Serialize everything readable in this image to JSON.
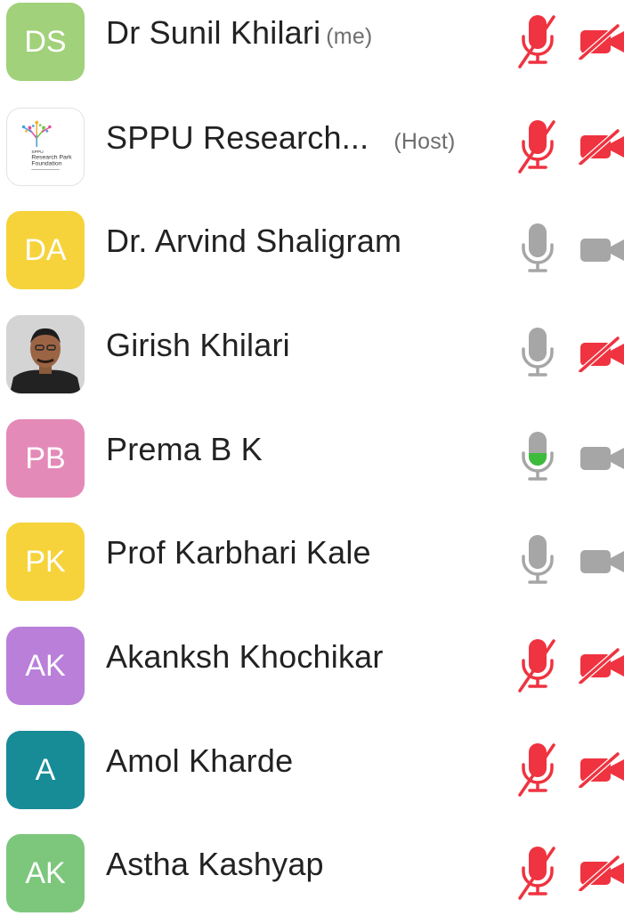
{
  "participants": [
    {
      "initials": "DS",
      "name": "Dr Sunil Khilari",
      "tag": "(me)",
      "avatar_type": "initials",
      "avatar_color": "#a1d17a",
      "mic": "muted",
      "video": "off"
    },
    {
      "initials": "",
      "name": "SPPU Research...",
      "tag": "(Host)",
      "avatar_type": "logo",
      "avatar_color": "#ffffff",
      "mic": "muted",
      "video": "off",
      "logo_text": {
        "line1": "SPPU",
        "line2": "Research Park",
        "line3": "Foundation"
      }
    },
    {
      "initials": "DA",
      "name": "Dr. Arvind Shaligram",
      "tag": "",
      "avatar_type": "initials",
      "avatar_color": "#f6d33b",
      "mic": "on",
      "video": "on"
    },
    {
      "initials": "",
      "name": "Girish Khilari",
      "tag": "",
      "avatar_type": "photo",
      "avatar_color": "#cfcfcf",
      "mic": "on",
      "video": "off"
    },
    {
      "initials": "PB",
      "name": "Prema B K",
      "tag": "",
      "avatar_type": "initials",
      "avatar_color": "#e48ab8",
      "mic": "speaking",
      "video": "on"
    },
    {
      "initials": "PK",
      "name": "Prof Karbhari Kale",
      "tag": "",
      "avatar_type": "initials",
      "avatar_color": "#f6d33b",
      "mic": "on",
      "video": "on"
    },
    {
      "initials": "AK",
      "name": "Akanksh Khochikar",
      "tag": "",
      "avatar_type": "initials",
      "avatar_color": "#b97fd9",
      "mic": "muted",
      "video": "off"
    },
    {
      "initials": "A",
      "name": "Amol Kharde",
      "tag": "",
      "avatar_type": "initials",
      "avatar_color": "#178c97",
      "mic": "muted",
      "video": "off"
    },
    {
      "initials": "AK",
      "name": "Astha Kashyap",
      "tag": "",
      "avatar_type": "initials",
      "avatar_color": "#7dc77c",
      "mic": "muted",
      "video": "off"
    }
  ],
  "icons": {
    "mic_muted": "mic-muted-icon",
    "mic_on": "mic-icon",
    "mic_speaking": "mic-speaking-icon",
    "video_off": "video-off-icon",
    "video_on": "video-icon"
  },
  "colors": {
    "muted_red": "#ef3340",
    "icon_gray": "#a6a6a6",
    "speaking_green": "#3dbb3d",
    "name_text": "#222222",
    "tag_text": "#6e6e6e"
  }
}
